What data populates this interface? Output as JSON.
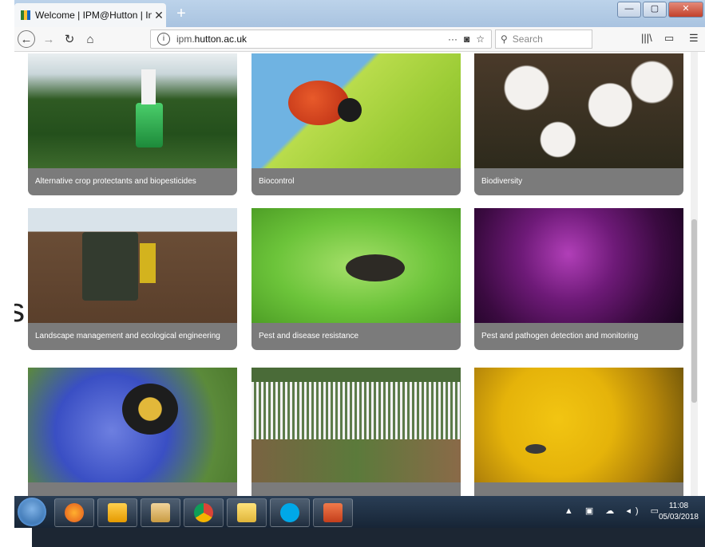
{
  "browser": {
    "tab_title": "Welcome | IPM@Hutton | Integ",
    "tab_close": "✕",
    "new_tab": "+",
    "url_host": "ipm.",
    "url_domain": "hutton.ac.uk",
    "url_more": "···",
    "search_placeholder": "Search",
    "window_min": "—",
    "window_max": "▢",
    "window_close": "✕"
  },
  "content": {
    "side_letter": "s",
    "cards": [
      {
        "label": "Alternative crop protectants and biopesticides",
        "image": "greenhouse-crop-trap"
      },
      {
        "label": "Biocontrol",
        "image": "ladybird-on-leaf"
      },
      {
        "label": "Biodiversity",
        "image": "white-wood-anemones"
      },
      {
        "label": "Landscape management and ecological engineering",
        "image": "tractor-in-field"
      },
      {
        "label": "Pest and disease resistance",
        "image": "weevil-on-leaf"
      },
      {
        "label": "Pest and pathogen detection and monitoring",
        "image": "purple-microscopy"
      },
      {
        "label": "",
        "image": "bumblebee-on-cornflower"
      },
      {
        "label": "",
        "image": "aerial-field-plots"
      },
      {
        "label": "",
        "image": "fly-on-yellow-flower"
      }
    ]
  },
  "taskbar": {
    "apps": [
      "firefox",
      "outlook",
      "file-explorer",
      "chrome",
      "folder",
      "skype",
      "powerpoint"
    ],
    "time": "11:08",
    "date": "05/03/2018"
  }
}
